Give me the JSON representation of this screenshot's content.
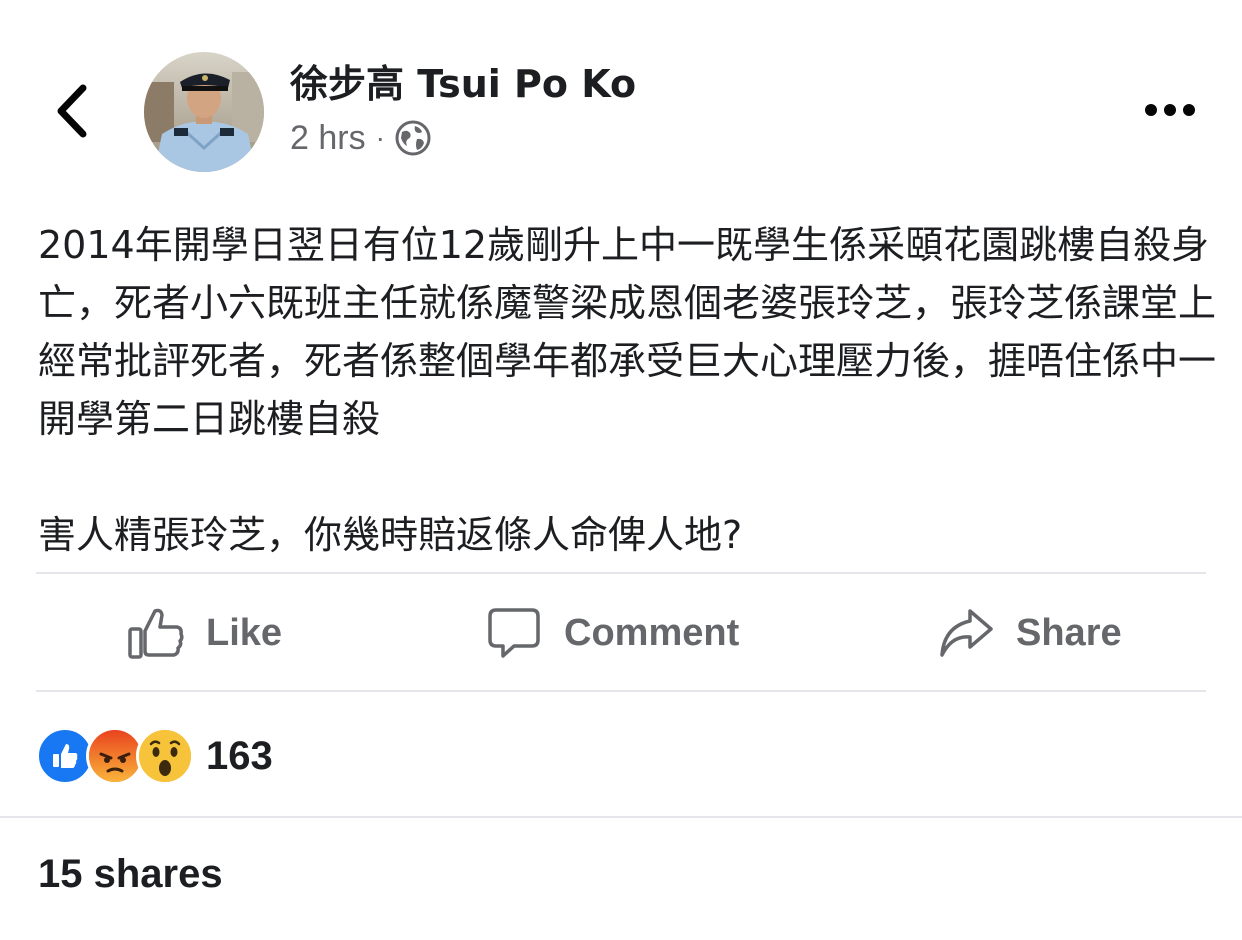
{
  "header": {
    "back_icon": "chevron-left-icon",
    "author_name": "徐步高 Tsui Po Ko",
    "timestamp": "2 hrs",
    "separator": "·",
    "privacy_icon": "globe-icon",
    "more_icon": "more-horizontal-icon"
  },
  "post": {
    "paragraphs": [
      "2014年開學日翌日有位12歲剛升上中一既學生係采頤花園跳樓自殺身亡，死者小六既班主任就係魔警梁成恩個老婆張玲芝，張玲芝係課堂上經常批評死者，死者係整個學年都承受巨大心理壓力後，捱唔住係中一開學第二日跳樓自殺",
      "害人精張玲芝，你幾時賠返條人命俾人地?"
    ]
  },
  "actions": {
    "like_label": "Like",
    "comment_label": "Comment",
    "share_label": "Share"
  },
  "reactions": {
    "icons": [
      "like-reaction-icon",
      "angry-reaction-icon",
      "wow-reaction-icon"
    ],
    "count": "163"
  },
  "footer": {
    "shares_label": "15 shares"
  },
  "colors": {
    "secondary_text": "#65676b",
    "primary_text": "#1c1e21",
    "like_blue": "#1877f2",
    "divider": "#e4e6eb"
  }
}
